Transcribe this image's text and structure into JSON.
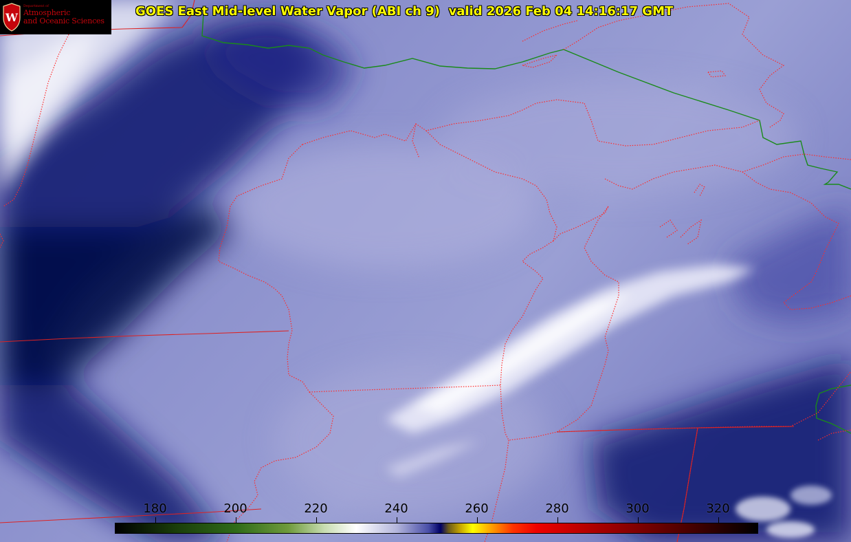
{
  "header": {
    "title": "GOES East Mid-level Water Vapor (ABI ch 9)  valid 2026 Feb 04 14:16:17 GMT"
  },
  "logo": {
    "dept": "Department of",
    "line1": "Atmospheric",
    "line2": "and Oceanic Sciences",
    "seal_letter": "W"
  },
  "colorbar": {
    "min": 170,
    "max": 330,
    "ticks": [
      {
        "value": 180,
        "label": "180"
      },
      {
        "value": 200,
        "label": "200"
      },
      {
        "value": 220,
        "label": "220"
      },
      {
        "value": 240,
        "label": "240"
      },
      {
        "value": 260,
        "label": "260"
      },
      {
        "value": 280,
        "label": "280"
      },
      {
        "value": 300,
        "label": "300"
      },
      {
        "value": 320,
        "label": "320"
      }
    ],
    "stops": [
      {
        "value": 170,
        "color": "#000000"
      },
      {
        "value": 185,
        "color": "#1a3d0a"
      },
      {
        "value": 200,
        "color": "#2f6b18"
      },
      {
        "value": 213,
        "color": "#6e9a3c"
      },
      {
        "value": 222,
        "color": "#c7dcb0"
      },
      {
        "value": 230,
        "color": "#ffffff"
      },
      {
        "value": 240,
        "color": "#b4b6dc"
      },
      {
        "value": 248,
        "color": "#4a4fa8"
      },
      {
        "value": 251,
        "color": "#000066"
      },
      {
        "value": 253,
        "color": "#6b5a1a"
      },
      {
        "value": 256,
        "color": "#c8a800"
      },
      {
        "value": 259,
        "color": "#ffff00"
      },
      {
        "value": 264,
        "color": "#ff9900"
      },
      {
        "value": 269,
        "color": "#ff3300"
      },
      {
        "value": 275,
        "color": "#ee0000"
      },
      {
        "value": 290,
        "color": "#aa0000"
      },
      {
        "value": 310,
        "color": "#550000"
      },
      {
        "value": 330,
        "color": "#000000"
      }
    ]
  },
  "colors": {
    "title": "#ffff00",
    "state_borders": "#ff2a2a",
    "country_border": "#1a8a1a",
    "logo_red": "#c5050c"
  }
}
